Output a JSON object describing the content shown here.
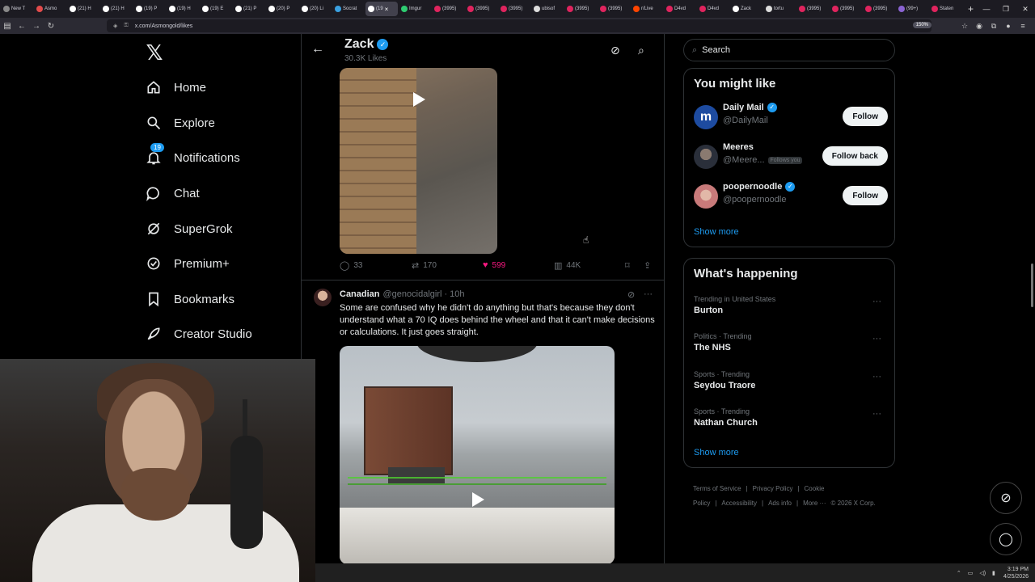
{
  "browser": {
    "tabs": [
      {
        "label": "New T",
        "color": "#888"
      },
      {
        "label": "Asmo",
        "color": "#e24b4b"
      },
      {
        "label": "(21) H",
        "color": "#fff"
      },
      {
        "label": "(21) H",
        "color": "#fff"
      },
      {
        "label": "(19) P",
        "color": "#fff"
      },
      {
        "label": "(19) H",
        "color": "#fff"
      },
      {
        "label": "(19) E",
        "color": "#fff"
      },
      {
        "label": "(21) P",
        "color": "#fff"
      },
      {
        "label": "(20) P",
        "color": "#fff"
      },
      {
        "label": "(20) Li",
        "color": "#fff"
      },
      {
        "label": "Socrat",
        "color": "#3aa0e0"
      },
      {
        "label": "(19",
        "color": "#fff",
        "active": true
      },
      {
        "label": "Imgur",
        "color": "#2ecc71"
      },
      {
        "label": "(3995)",
        "color": "#e0245e"
      },
      {
        "label": "(3995)",
        "color": "#e0245e"
      },
      {
        "label": "(3995)",
        "color": "#e0245e"
      },
      {
        "label": "ubisof",
        "color": "#ddd"
      },
      {
        "label": "(3995)",
        "color": "#e0245e"
      },
      {
        "label": "(3995)",
        "color": "#e0245e"
      },
      {
        "label": "r/Live",
        "color": "#ff4500"
      },
      {
        "label": "D4vd",
        "color": "#e0245e"
      },
      {
        "label": "D4vd",
        "color": "#e0245e"
      },
      {
        "label": "Zack",
        "color": "#fff"
      },
      {
        "label": "tortu",
        "color": "#ddd"
      },
      {
        "label": "(3995)",
        "color": "#e0245e"
      },
      {
        "label": "(3995)",
        "color": "#e0245e"
      },
      {
        "label": "(3995)",
        "color": "#e0245e"
      },
      {
        "label": "(99+)",
        "color": "#8a63d2"
      },
      {
        "label": "Staten",
        "color": "#e0245e"
      }
    ],
    "url": "x.com/Asmongold/likes",
    "zoom": "150%"
  },
  "nav": {
    "home": "Home",
    "explore": "Explore",
    "notifications": "Notifications",
    "notifications_badge": "19",
    "chat": "Chat",
    "supergrok": "SuperGrok",
    "premium": "Premium+",
    "bookmarks": "Bookmarks",
    "creator_studio": "Creator Studio"
  },
  "profile": {
    "name": "Zack",
    "likes": "30.3K Likes"
  },
  "post1": {
    "replies": "33",
    "reposts": "170",
    "likes": "599",
    "views": "44K"
  },
  "post2": {
    "name": "Canadian",
    "handle": "@genocidalgirl",
    "time": "· 10h",
    "text": "Some are confused why he didn't do anything but that's because they don't understand what a 70 IQ does behind the wheel and that it can't make decisions or calculations. It just goes straight."
  },
  "search": {
    "placeholder": "Search"
  },
  "who_to_follow": {
    "title": "You might like",
    "users": [
      {
        "name": "Daily Mail",
        "handle": "@DailyMail",
        "verified": true,
        "button": "Follow",
        "follows_you": ""
      },
      {
        "name": "Meeres",
        "handle": "@Meere...",
        "verified": false,
        "button": "Follow back",
        "follows_you": "Follows you"
      },
      {
        "name": "poopernoodle",
        "handle": "@poopernoodle",
        "verified": true,
        "button": "Follow",
        "follows_you": ""
      }
    ],
    "show_more": "Show more"
  },
  "trends": {
    "title": "What's happening",
    "items": [
      {
        "category": "Trending in United States",
        "topic": "Burton"
      },
      {
        "category": "Politics · Trending",
        "topic": "The NHS"
      },
      {
        "category": "Sports · Trending",
        "topic": "Seydou Traore"
      },
      {
        "category": "Sports · Trending",
        "topic": "Nathan Church"
      }
    ],
    "show_more": "Show more"
  },
  "footer": {
    "links": [
      "Terms of Service",
      "|",
      "Privacy Policy",
      "|",
      "Cookie Policy",
      "|",
      "Accessibility",
      "|",
      "Ads info",
      "|",
      "More ···",
      "© 2026 X Corp."
    ]
  },
  "taskbar": {
    "time": "3:19 PM",
    "date": "4/25/2026"
  },
  "icons": {
    "x_logo": "x-logo-icon",
    "home": "home-icon",
    "explore": "search-icon",
    "notifications": "bell-icon",
    "chat": "chat-icon",
    "supergrok": "grok-icon",
    "premium": "premium-icon",
    "bookmarks": "bookmark-icon",
    "creator": "rocket-icon"
  },
  "colors": {
    "accent": "#1d9bf0",
    "like": "#f91880",
    "bg": "#000000",
    "border": "#2f3336"
  }
}
